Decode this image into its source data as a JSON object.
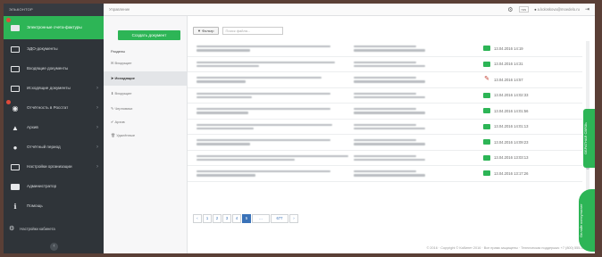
{
  "sidebar": {
    "brand": "ЭЛЬКОНТОР",
    "items": [
      {
        "label": "Электронные счета-фактуры",
        "icon": "invoice-icon",
        "active": true,
        "badge": true
      },
      {
        "label": "ЭДО-документы",
        "icon": "card-icon",
        "active": false
      },
      {
        "label": "Входящие документы",
        "icon": "card-icon",
        "active": false
      },
      {
        "label": "Исходящие документы",
        "icon": "card-icon",
        "active": false
      },
      {
        "label": "Отчётность в Росстат",
        "icon": "eye-icon",
        "active": false,
        "badge": true
      },
      {
        "label": "Архив",
        "icon": "lock-icon",
        "active": false
      },
      {
        "label": "Отчётный период",
        "icon": "user-icon",
        "active": false
      },
      {
        "label": "Настройки организации",
        "icon": "card-icon",
        "active": false
      },
      {
        "label": "Администратор",
        "icon": "card-icon",
        "active": false
      },
      {
        "label": "Помощь",
        "icon": "info-icon",
        "active": false
      }
    ],
    "bottom_label": "Настройки кабинета",
    "collapse_icon": "‹"
  },
  "topbar": {
    "breadcrumb": "Управление",
    "lang": "rus",
    "user": "a.koloskova@moedelo.ru"
  },
  "left_panel": {
    "create_button": "Создать документ",
    "section_title": "Разделы",
    "items": [
      "Входящие",
      "Входящие",
      "Исходящие",
      "Черновики",
      "Архив",
      "Удалённые"
    ],
    "active_index": 2
  },
  "toolbar": {
    "filter_label": "▼ Фильтр",
    "search_placeholder": "Поиск файла..."
  },
  "rows": [
    {
      "status": "ok",
      "date": "13.04.2016 14:19"
    },
    {
      "status": "ok",
      "date": "13.04.2016 14:31"
    },
    {
      "status": "edit",
      "date": "13.04.2016 14:57"
    },
    {
      "status": "ok",
      "date": "13.04.2016 14:02:33"
    },
    {
      "status": "ok",
      "date": "13.04.2016 14:01:56"
    },
    {
      "status": "ok",
      "date": "13.04.2016 14:01:13"
    },
    {
      "status": "ok",
      "date": "13.04.2016 14:09:23"
    },
    {
      "status": "ok",
      "date": "13.04.2016 13:03:13"
    },
    {
      "status": "ok",
      "date": "13.04.2016 13:17:26"
    }
  ],
  "pager": {
    "pages": [
      "‹",
      "1",
      "2",
      "3",
      "4",
      "5",
      "...",
      "677",
      "›"
    ],
    "active": "5"
  },
  "footer": "© 2016 · Copyright © Кабинет 2016 · Все права защищены · Техническая поддержка: +7 (800) 555-00-11",
  "side_tabs": {
    "feedback": "ОБРАТНАЯ СВЯЗЬ",
    "online": "Онлайн консультант"
  },
  "colors": {
    "accent": "#2db556",
    "sidebar": "#2f3439",
    "link": "#3a72b8",
    "badge": "#e04a3a"
  }
}
